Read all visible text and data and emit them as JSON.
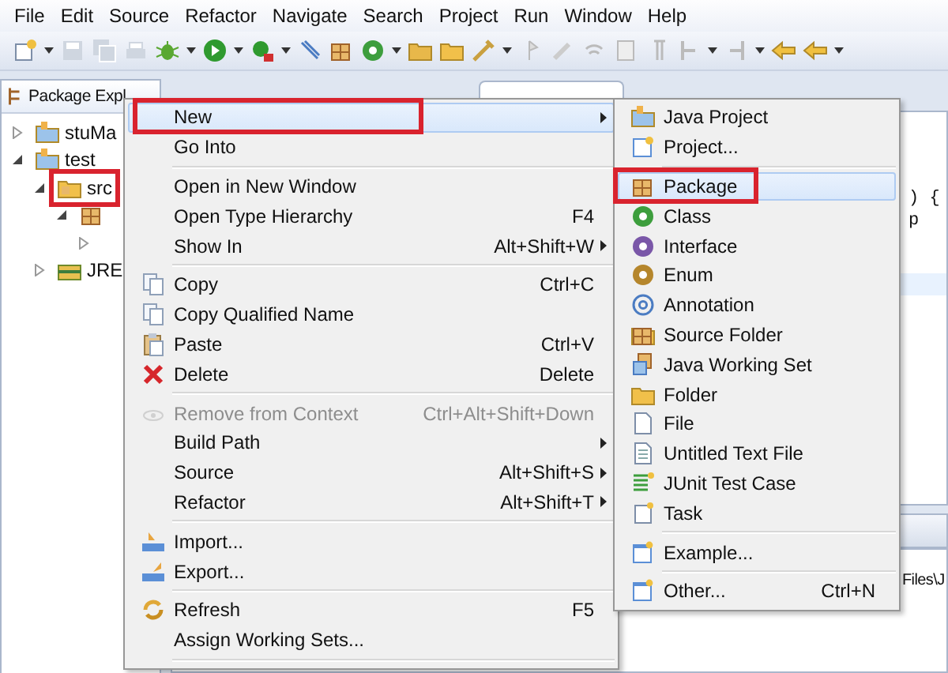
{
  "menubar": [
    "File",
    "Edit",
    "Source",
    "Refactor",
    "Navigate",
    "Search",
    "Project",
    "Run",
    "Window",
    "Help"
  ],
  "explorer": {
    "tab_title": "Package Expl",
    "tree": [
      {
        "label": "stuMa",
        "expanded": false,
        "marked": false
      },
      {
        "label": "test",
        "expanded": true,
        "marked": false,
        "children": [
          {
            "label": "src",
            "expanded": true,
            "marked": true,
            "children": [
              {
                "expanded": true,
                "marked": false,
                "children": [
                  {
                    "expanded": false
                  }
                ]
              }
            ]
          },
          {
            "label": "JRE",
            "expanded": false,
            "marked": false
          }
        ]
      }
    ]
  },
  "editor": {
    "code_lines": [
      ") {",
      "p"
    ],
    "console_text": "Files\\J"
  },
  "context_menu": [
    {
      "kind": "item",
      "label": "New",
      "submenu": true,
      "selected": true,
      "marked": true,
      "disabled": false
    },
    {
      "kind": "item",
      "label": "Go Into",
      "submenu": false,
      "selected": false,
      "marked": false,
      "disabled": false
    },
    {
      "kind": "separator"
    },
    {
      "kind": "item",
      "label": "Open in New Window",
      "submenu": false,
      "selected": false,
      "marked": false,
      "disabled": false
    },
    {
      "kind": "item",
      "label": "Open Type Hierarchy",
      "shortcut": "F4",
      "submenu": false,
      "selected": false,
      "marked": false,
      "disabled": false
    },
    {
      "kind": "item",
      "label": "Show In",
      "shortcut": "Alt+Shift+W",
      "submenu": true,
      "selected": false,
      "marked": false,
      "disabled": false
    },
    {
      "kind": "separator"
    },
    {
      "kind": "item",
      "label": "Copy",
      "shortcut": "Ctrl+C",
      "submenu": false,
      "selected": false,
      "marked": false,
      "disabled": false
    },
    {
      "kind": "item",
      "label": "Copy Qualified Name",
      "submenu": false,
      "selected": false,
      "marked": false,
      "disabled": false
    },
    {
      "kind": "item",
      "label": "Paste",
      "shortcut": "Ctrl+V",
      "submenu": false,
      "selected": false,
      "marked": false,
      "disabled": false
    },
    {
      "kind": "item",
      "label": "Delete",
      "shortcut": "Delete",
      "submenu": false,
      "selected": false,
      "marked": false,
      "disabled": false
    },
    {
      "kind": "separator"
    },
    {
      "kind": "item",
      "label": "Remove from Context",
      "shortcut": "Ctrl+Alt+Shift+Down",
      "submenu": false,
      "selected": false,
      "marked": false,
      "disabled": true
    },
    {
      "kind": "item",
      "label": "Build Path",
      "submenu": true,
      "selected": false,
      "marked": false,
      "disabled": false
    },
    {
      "kind": "item",
      "label": "Source",
      "shortcut": "Alt+Shift+S",
      "submenu": true,
      "selected": false,
      "marked": false,
      "disabled": false
    },
    {
      "kind": "item",
      "label": "Refactor",
      "shortcut": "Alt+Shift+T",
      "submenu": true,
      "selected": false,
      "marked": false,
      "disabled": false
    },
    {
      "kind": "separator"
    },
    {
      "kind": "item",
      "label": "Import...",
      "submenu": false,
      "selected": false,
      "marked": false,
      "disabled": false
    },
    {
      "kind": "item",
      "label": "Export...",
      "submenu": false,
      "selected": false,
      "marked": false,
      "disabled": false
    },
    {
      "kind": "separator"
    },
    {
      "kind": "item",
      "label": "Refresh",
      "shortcut": "F5",
      "submenu": false,
      "selected": false,
      "marked": false,
      "disabled": false
    },
    {
      "kind": "item",
      "label": "Assign Working Sets...",
      "submenu": false,
      "selected": false,
      "marked": false,
      "disabled": false
    },
    {
      "kind": "separator"
    }
  ],
  "submenu": [
    {
      "kind": "item",
      "label": "Java Project",
      "selected": false,
      "marked": false
    },
    {
      "kind": "item",
      "label": "Project...",
      "selected": false,
      "marked": false
    },
    {
      "kind": "separator"
    },
    {
      "kind": "item",
      "label": "Package",
      "selected": true,
      "marked": true
    },
    {
      "kind": "item",
      "label": "Class",
      "selected": false,
      "marked": false
    },
    {
      "kind": "item",
      "label": "Interface",
      "selected": false,
      "marked": false
    },
    {
      "kind": "item",
      "label": "Enum",
      "selected": false,
      "marked": false
    },
    {
      "kind": "item",
      "label": "Annotation",
      "selected": false,
      "marked": false
    },
    {
      "kind": "item",
      "label": "Source Folder",
      "selected": false,
      "marked": false
    },
    {
      "kind": "item",
      "label": "Java Working Set",
      "selected": false,
      "marked": false
    },
    {
      "kind": "item",
      "label": "Folder",
      "selected": false,
      "marked": false
    },
    {
      "kind": "item",
      "label": "File",
      "selected": false,
      "marked": false
    },
    {
      "kind": "item",
      "label": "Untitled Text File",
      "selected": false,
      "marked": false
    },
    {
      "kind": "item",
      "label": "JUnit Test Case",
      "selected": false,
      "marked": false
    },
    {
      "kind": "item",
      "label": "Task",
      "selected": false,
      "marked": false
    },
    {
      "kind": "separator"
    },
    {
      "kind": "item",
      "label": "Example...",
      "selected": false,
      "marked": false
    },
    {
      "kind": "separator"
    },
    {
      "kind": "item",
      "label": "Other...",
      "shortcut": "Ctrl+N",
      "selected": false,
      "marked": false
    }
  ]
}
